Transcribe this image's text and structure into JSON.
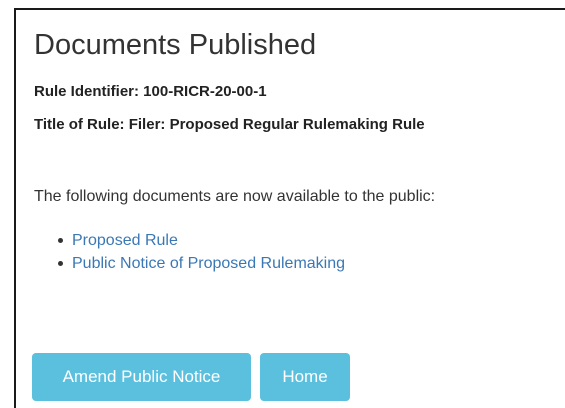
{
  "header": {
    "title": "Documents Published"
  },
  "rule": {
    "identifier_text": "Rule Identifier: 100-RICR-20-00-1",
    "title_text": "Title of Rule: Filer: Proposed Regular Rulemaking Rule"
  },
  "content": {
    "intro": "The following documents are now available to the public:",
    "documents": [
      {
        "label": "Proposed Rule"
      },
      {
        "label": "Public Notice of Proposed Rulemaking"
      }
    ]
  },
  "actions": {
    "amend_label": "Amend Public Notice",
    "home_label": "Home"
  },
  "colors": {
    "link": "#3a78b5",
    "button_bg": "#5bc0de",
    "button_text": "#ffffff",
    "border": "#1a1a1a"
  }
}
